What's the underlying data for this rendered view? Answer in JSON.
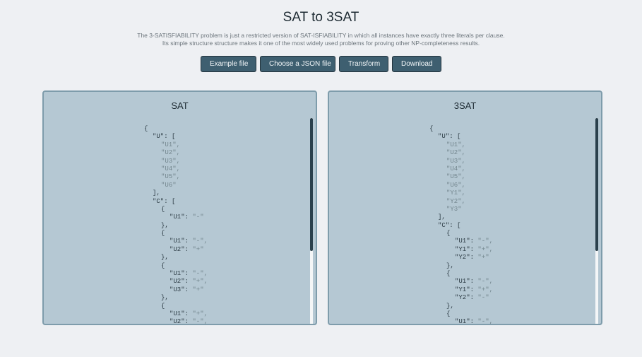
{
  "page": {
    "title": "SAT to 3SAT",
    "description_line1": "The 3-SATISFIABILITY problem is just a restricted version of SAT-ISFIABILITY in which all instances have exactly three literals per clause.",
    "description_line2": "Its simple structure structure makes it one of the most widely used problems for proving other NP-completeness results."
  },
  "toolbar": {
    "example_label": "Example file",
    "choose_label": "Choose a JSON file",
    "transform_label": "Transform",
    "download_label": "Download"
  },
  "panels": {
    "sat": {
      "title": "SAT",
      "lines": [
        {
          "indent": 0,
          "key": "{",
          "val": ""
        },
        {
          "indent": 1,
          "key": "\"U\": [",
          "val": ""
        },
        {
          "indent": 2,
          "key": "",
          "val": "\"U1\","
        },
        {
          "indent": 2,
          "key": "",
          "val": "\"U2\","
        },
        {
          "indent": 2,
          "key": "",
          "val": "\"U3\","
        },
        {
          "indent": 2,
          "key": "",
          "val": "\"U4\","
        },
        {
          "indent": 2,
          "key": "",
          "val": "\"U5\","
        },
        {
          "indent": 2,
          "key": "",
          "val": "\"U6\""
        },
        {
          "indent": 1,
          "key": "],",
          "val": ""
        },
        {
          "indent": 1,
          "key": "\"C\": [",
          "val": ""
        },
        {
          "indent": 2,
          "key": "{",
          "val": ""
        },
        {
          "indent": 3,
          "key": "\"U1\": ",
          "val": "\"-\""
        },
        {
          "indent": 2,
          "key": "},",
          "val": ""
        },
        {
          "indent": 2,
          "key": "{",
          "val": ""
        },
        {
          "indent": 3,
          "key": "\"U1\": ",
          "val": "\"-\","
        },
        {
          "indent": 3,
          "key": "\"U2\": ",
          "val": "\"+\""
        },
        {
          "indent": 2,
          "key": "},",
          "val": ""
        },
        {
          "indent": 2,
          "key": "{",
          "val": ""
        },
        {
          "indent": 3,
          "key": "\"U1\": ",
          "val": "\"-\","
        },
        {
          "indent": 3,
          "key": "\"U2\": ",
          "val": "\"+\","
        },
        {
          "indent": 3,
          "key": "\"U3\": ",
          "val": "\"+\""
        },
        {
          "indent": 2,
          "key": "},",
          "val": ""
        },
        {
          "indent": 2,
          "key": "{",
          "val": ""
        },
        {
          "indent": 3,
          "key": "\"U1\": ",
          "val": "\"+\","
        },
        {
          "indent": 3,
          "key": "\"U2\": ",
          "val": "\"-\","
        }
      ]
    },
    "three_sat": {
      "title": "3SAT",
      "lines": [
        {
          "indent": 0,
          "key": "{",
          "val": ""
        },
        {
          "indent": 1,
          "key": "\"U\": [",
          "val": ""
        },
        {
          "indent": 2,
          "key": "",
          "val": "\"U1\","
        },
        {
          "indent": 2,
          "key": "",
          "val": "\"U2\","
        },
        {
          "indent": 2,
          "key": "",
          "val": "\"U3\","
        },
        {
          "indent": 2,
          "key": "",
          "val": "\"U4\","
        },
        {
          "indent": 2,
          "key": "",
          "val": "\"U5\","
        },
        {
          "indent": 2,
          "key": "",
          "val": "\"U6\","
        },
        {
          "indent": 2,
          "key": "",
          "val": "\"Y1\","
        },
        {
          "indent": 2,
          "key": "",
          "val": "\"Y2\","
        },
        {
          "indent": 2,
          "key": "",
          "val": "\"Y3\""
        },
        {
          "indent": 1,
          "key": "],",
          "val": ""
        },
        {
          "indent": 1,
          "key": "\"C\": [",
          "val": ""
        },
        {
          "indent": 2,
          "key": "{",
          "val": ""
        },
        {
          "indent": 3,
          "key": "\"U1\": ",
          "val": "\"-\","
        },
        {
          "indent": 3,
          "key": "\"Y1\": ",
          "val": "\"+\","
        },
        {
          "indent": 3,
          "key": "\"Y2\": ",
          "val": "\"+\""
        },
        {
          "indent": 2,
          "key": "},",
          "val": ""
        },
        {
          "indent": 2,
          "key": "{",
          "val": ""
        },
        {
          "indent": 3,
          "key": "\"U1\": ",
          "val": "\"-\","
        },
        {
          "indent": 3,
          "key": "\"Y1\": ",
          "val": "\"+\","
        },
        {
          "indent": 3,
          "key": "\"Y2\": ",
          "val": "\"-\""
        },
        {
          "indent": 2,
          "key": "},",
          "val": ""
        },
        {
          "indent": 2,
          "key": "{",
          "val": ""
        },
        {
          "indent": 3,
          "key": "\"U1\": ",
          "val": "\"-\","
        }
      ]
    }
  },
  "colors": {
    "background": "#eef0f3",
    "button": "#3e5f70",
    "panel": "#b5c8d3",
    "panel_border": "#7e9cab",
    "string_value": "#74878f",
    "scroll_thumb": "#2a404c"
  }
}
